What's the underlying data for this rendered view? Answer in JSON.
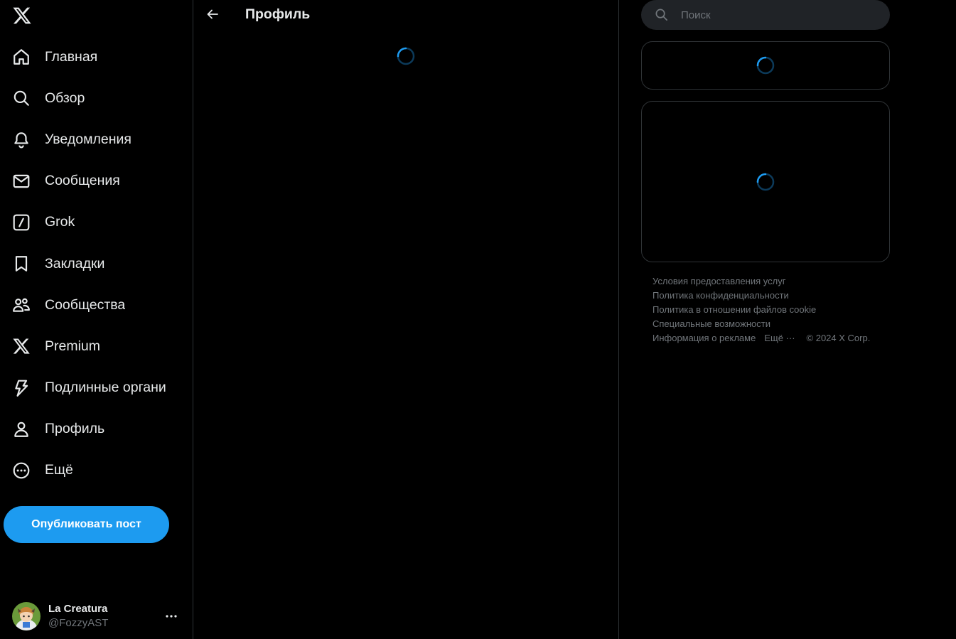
{
  "sidebar": {
    "nav": [
      {
        "label": "Главная",
        "icon": "home-icon"
      },
      {
        "label": "Обзор",
        "icon": "search-icon"
      },
      {
        "label": "Уведомления",
        "icon": "bell-icon"
      },
      {
        "label": "Сообщения",
        "icon": "envelope-icon"
      },
      {
        "label": "Grok",
        "icon": "grok-icon"
      },
      {
        "label": "Закладки",
        "icon": "bookmark-icon"
      },
      {
        "label": "Сообщества",
        "icon": "people-icon"
      },
      {
        "label": "Premium",
        "icon": "x-logo-icon"
      },
      {
        "label": "Подлинные органи",
        "icon": "lightning-icon"
      },
      {
        "label": "Профиль",
        "icon": "user-icon"
      },
      {
        "label": "Ещё",
        "icon": "more-circle-icon"
      }
    ],
    "post_button": "Опубликовать пост",
    "account": {
      "name": "La Creatura",
      "handle": "@FozzyAST"
    }
  },
  "main": {
    "title": "Профиль"
  },
  "right": {
    "search_placeholder": "Поиск",
    "footer": {
      "terms": "Условия предоставления услуг",
      "privacy": "Политика конфиденциальности",
      "cookies": "Политика в отношении файлов cookie",
      "accessibility": "Специальные возможности",
      "ads": "Информация о рекламе",
      "more": "Ещё ···",
      "copyright": "© 2024 X Corp."
    }
  },
  "colors": {
    "accent": "#1d9bf0",
    "background": "#000000",
    "border": "#2f3336",
    "muted_text": "#71767b"
  }
}
